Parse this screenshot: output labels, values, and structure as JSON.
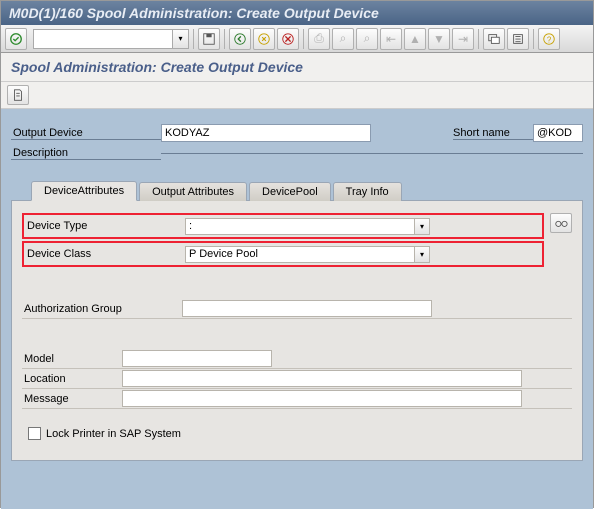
{
  "window": {
    "title": "M0D(1)/160 Spool Administration: Create Output Device"
  },
  "heading": "Spool Administration: Create Output Device",
  "top": {
    "output_device_label": "Output Device",
    "output_device_value": "KODYAZ",
    "short_name_label": "Short name",
    "short_name_value": "@KOD",
    "description_label": "Description",
    "description_value": ""
  },
  "tabs": {
    "t1": "DeviceAttributes",
    "t2": "Output Attributes",
    "t3": "DevicePool",
    "t4": "Tray Info"
  },
  "attrs": {
    "device_type_label": "Device Type",
    "device_type_value": ":",
    "device_class_label": "Device Class",
    "device_class_value": "P Device Pool",
    "auth_group_label": "Authorization Group",
    "auth_group_value": "",
    "model_label": "Model",
    "model_value": "",
    "location_label": "Location",
    "location_value": "",
    "message_label": "Message",
    "message_value": "",
    "lock_label": "Lock Printer in SAP System"
  }
}
